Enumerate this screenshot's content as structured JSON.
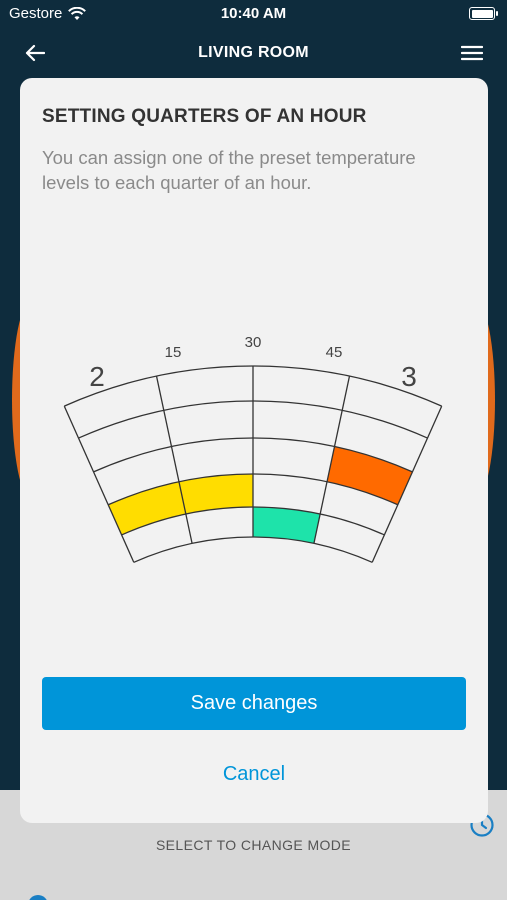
{
  "status_bar": {
    "carrier": "Gestore",
    "time": "10:40 AM"
  },
  "nav": {
    "title": "LIVING ROOM"
  },
  "modal": {
    "title": "SETTING QUARTERS OF AN HOUR",
    "description": "You can assign one of the preset temperature levels to each quarter of an hour.",
    "dial": {
      "hour_start": "2",
      "hour_end": "3",
      "minute_labels": [
        "15",
        "30",
        "45"
      ],
      "colors": {
        "level_orange": "#ff6a00",
        "level_yellow": "#ffdd00",
        "level_green": "#1ee3aa"
      },
      "quarters": [
        {
          "minute": "0",
          "level": 2,
          "color": "#ffdd00"
        },
        {
          "minute": "15",
          "level": 2,
          "color": "#ffdd00"
        },
        {
          "minute": "30",
          "level": 3,
          "color": "#1ee3aa"
        },
        {
          "minute": "45",
          "level": 1,
          "color": "#ff6a00"
        }
      ]
    },
    "save_label": "Save changes",
    "cancel_label": "Cancel"
  },
  "bottom_sheet": {
    "label": "SELECT TO CHANGE MODE"
  },
  "theme": {
    "accent": "#0095d9",
    "background": "#0e2c3d"
  }
}
